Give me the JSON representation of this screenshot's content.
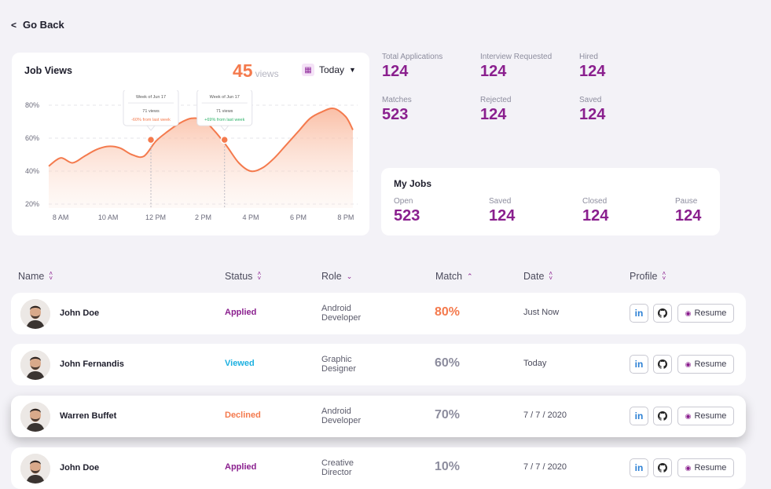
{
  "nav": {
    "back_chevron": "<",
    "back_label": "Go Back"
  },
  "job_views": {
    "title": "Job Views",
    "count": "45",
    "unit": "views",
    "period": "Today",
    "chart_data": {
      "type": "area",
      "x_ticks": [
        "8 AM",
        "10 AM",
        "12 PM",
        "2 PM",
        "4 PM",
        "6 PM",
        "8 PM"
      ],
      "y_ticks": [
        "80%",
        "60%",
        "40%",
        "20%"
      ],
      "ylim": [
        20,
        80
      ],
      "x": [
        7.5,
        8,
        8.5,
        9,
        9.5,
        10,
        10.5,
        11,
        11.5,
        12,
        12.5,
        13,
        13.5,
        14,
        14.5,
        15,
        15.5,
        16,
        16.5,
        17,
        17.5,
        18,
        18.5,
        19,
        19.5,
        20,
        20.3
      ],
      "y": [
        43,
        48,
        45,
        49,
        53,
        55,
        54,
        50,
        49,
        58,
        64,
        69,
        72,
        71,
        64,
        55,
        45,
        40,
        42,
        48,
        56,
        64,
        72,
        76,
        78,
        73,
        65
      ],
      "grid": true,
      "markers": [
        {
          "x": 11.8,
          "y": 59,
          "tooltip": {
            "title": "Week of Jun 17",
            "views": "71 views",
            "change": "-60% from last week",
            "color": "#f47a4d"
          }
        },
        {
          "x": 14.9,
          "y": 59,
          "tooltip": {
            "title": "Week of Jun 17",
            "views": "71 views",
            "change": "+69% from last week",
            "color": "#2fb36b"
          }
        }
      ],
      "colors": {
        "line": "#f47a4d",
        "fill": "#fbd0bd"
      }
    }
  },
  "stats": [
    {
      "label": "Total Applications",
      "value": "124"
    },
    {
      "label": "Interview Requested",
      "value": "124"
    },
    {
      "label": "Hired",
      "value": "124"
    },
    {
      "label": "Matches",
      "value": "523"
    },
    {
      "label": "Rejected",
      "value": "124"
    },
    {
      "label": "Saved",
      "value": "124"
    }
  ],
  "my_jobs": {
    "title": "My Jobs",
    "items": [
      {
        "label": "Open",
        "value": "523"
      },
      {
        "label": "Saved",
        "value": "124"
      },
      {
        "label": "Closed",
        "value": "124"
      },
      {
        "label": "Pause",
        "value": "124"
      }
    ]
  },
  "table": {
    "headers": [
      "Name",
      "Status",
      "Role",
      "Match",
      "Date",
      "Profile"
    ],
    "rows": [
      {
        "name": "John Doe",
        "status": "Applied",
        "status_color": "#8a1f8e",
        "role": "Android Developer",
        "match": "80%",
        "match_color": "#f47a4d",
        "date": "Just Now"
      },
      {
        "name": "John Fernandis",
        "status": "Viewed",
        "status_color": "#1cb0e0",
        "role": "Graphic Designer",
        "match": "60%",
        "match_color": "#8d8d9e",
        "date": "Today"
      },
      {
        "name": "Warren Buffet",
        "status": "Declined",
        "status_color": "#f47a4d",
        "role": "Android Developer",
        "match": "70%",
        "match_color": "#8d8d9e",
        "date": "7 / 7 / 2020"
      },
      {
        "name": "John Doe",
        "status": "Applied",
        "status_color": "#8a1f8e",
        "role": "Creative Director",
        "match": "10%",
        "match_color": "#8d8d9e",
        "date": "7 / 7 / 2020"
      }
    ],
    "linkedin_label": "in",
    "resume_label": "Resume"
  },
  "colors": {
    "accent": "#8a1f8e",
    "orange": "#f47a4d",
    "bg": "#f3f2f7"
  }
}
